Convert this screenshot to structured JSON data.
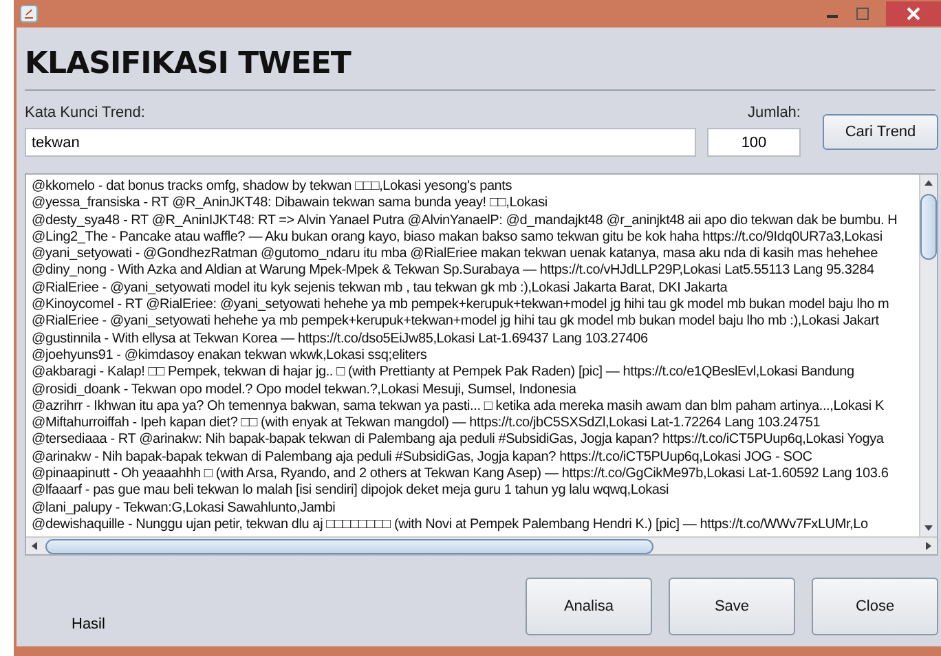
{
  "heading": "KLASIFIKASI TWEET",
  "keyword": {
    "label": "Kata Kunci Trend:",
    "value": "tekwan"
  },
  "count": {
    "label": "Jumlah:",
    "value": "100"
  },
  "search_button": "Cari Trend",
  "tweets": [
    "@kkomelo - dat bonus tracks omfg, shadow by tekwan □□□,Lokasi yesong's pants",
    "@yessa_fransiska - RT @R_AninJKT48: Dibawain tekwan sama bunda yeay! □□,Lokasi",
    "@desty_sya48 - RT @R_AninIJKT48: RT => Alvin Yanael Putra @AlvinYanaelP: @d_mandajkt48 @r_aninjkt48 aii apo dio tekwan dak be bumbu. H",
    "@Ling2_The - Pancake atau waffle? — Aku bukan orang kayo, biaso makan bakso samo tekwan gitu be kok haha https://t.co/9Idq0UR7a3,Lokasi",
    "@yani_setyowati - @GondhezRatman  @gutomo_ndaru itu mba @RialEriee makan tekwan uenak katanya, masa aku nda di kasih mas hehehee",
    "@diny_nong - With Azka and Aldian at Warung Mpek-Mpek & Tekwan Sp.Surabaya — https://t.co/vHJdLLP29P,Lokasi Lat5.55113 Lang 95.3284",
    "@RialEriee - @yani_setyowati model itu kyk sejenis tekwan mb , tau tekwan gk mb :),Lokasi Jakarta Barat, DKI Jakarta",
    "@Kinoycomel - RT @RialEriee: @yani_setyowati hehehe ya mb pempek+kerupuk+tekwan+model jg hihi tau gk model mb bukan model baju lho m",
    "@RialEriee - @yani_setyowati hehehe ya mb pempek+kerupuk+tekwan+model jg hihi tau gk model mb bukan model baju lho mb :),Lokasi Jakart",
    "@gustinnila - With ellysa at Tekwan Korea — https://t.co/dso5EiJw85,Lokasi Lat-1.69437 Lang 103.27406",
    "@joehyuns91 - @kimdasoy enakan tekwan wkwk,Lokasi ssq;eliters",
    "@akbaragi - Kalap! □□ Pempek, tekwan di hajar jg.. □ (with Prettianty at Pempek Pak Raden) [pic] — https://t.co/e1QBeslEvl,Lokasi Bandung",
    "@rosidi_doank - Tekwan opo model.? Opo model tekwan.?,Lokasi Mesuji, Sumsel, Indonesia",
    "@azrihrr - Ikhwan itu apa ya? Oh temennya bakwan, sama tekwan ya pasti... □ ketika ada mereka masih awam dan blm paham artinya...,Lokasi K",
    "@Miftahurroiffah - Ipeh kapan diet? □□ (with enyak at Tekwan mangdol) — https://t.co/jbC5SXSdZl,Lokasi Lat-1.72264 Lang 103.24751",
    "@tersediaaa - RT @arinakw: Nih bapak-bapak tekwan di Palembang aja peduli #SubsidiGas, Jogja kapan? https://t.co/iCT5PUup6q,Lokasi Yogya",
    "@arinakw - Nih bapak-bapak tekwan di Palembang aja peduli #SubsidiGas, Jogja kapan? https://t.co/iCT5PUup6q,Lokasi JOG - SOC",
    "@pinaapinutt - Oh yeaaahhh □ (with Arsa, Ryando, and 2 others at Tekwan Kang Asep) — https://t.co/GgCikMe97b,Lokasi Lat-1.60592 Lang 103.6",
    "@lfaaarf - pas gue mau beli tekwan lo malah [isi sendiri] dipojok deket meja guru 1 tahun yg lalu wqwq,Lokasi",
    "@lani_palupy - Tekwan:G,Lokasi Sawahlunto,Jambi",
    "@dewishaquille - Nunggu ujan petir, tekwan dlu aj □□□□□□□□ (with Novi at Pempek Palembang Hendri K.) [pic] — https://t.co/WWv7FxLUMr,Lo"
  ],
  "result_label": "Hasil",
  "buttons": [
    "Analisa",
    "Save",
    "Close"
  ]
}
